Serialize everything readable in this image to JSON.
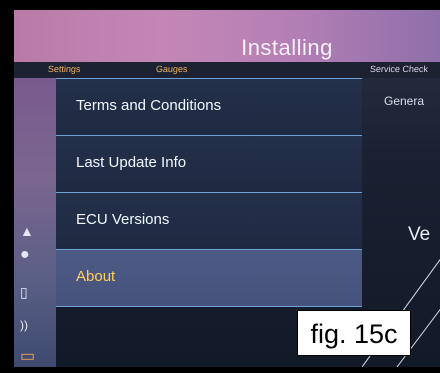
{
  "status": {
    "title": "Installing"
  },
  "tabs": [
    {
      "label": "Settings"
    },
    {
      "label": "Gauges"
    },
    {
      "label": "Service Check"
    }
  ],
  "sidebar": {
    "icons": [
      "navigation-icon",
      "phone-icon",
      "fuel-icon",
      "radio-icon",
      "folder-icon"
    ]
  },
  "menu": {
    "items": [
      {
        "label": "Terms and Conditions"
      },
      {
        "label": "Last Update Info"
      },
      {
        "label": "ECU Versions"
      },
      {
        "label": "About"
      }
    ],
    "selected": "About"
  },
  "right_pane": {
    "general_label": "Genera",
    "ve_label": "Ve"
  },
  "figure_caption": "fig. 15c"
}
